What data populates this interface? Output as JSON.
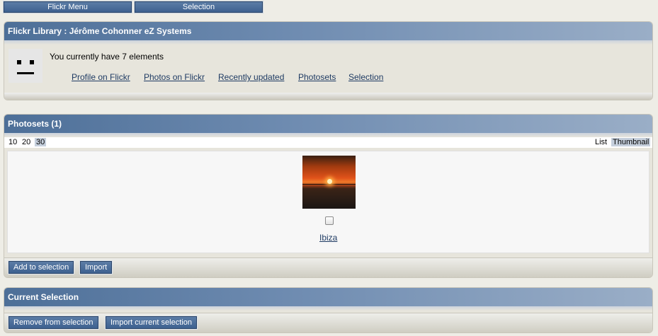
{
  "topnav": {
    "menu_label": "Flickr Menu",
    "selection_label": "Selection"
  },
  "library": {
    "title": "Flickr Library : Jérôme Cohonner eZ Systems",
    "count_text": "You currently have 7 elements",
    "links": [
      "Profile on Flickr",
      "Photos on Flickr",
      "Recently updated",
      "Photosets",
      "Selection"
    ]
  },
  "photosets": {
    "title": "Photosets (1)",
    "page_sizes": [
      "10",
      "20",
      "30"
    ],
    "page_size_selected": "30",
    "view_modes": [
      "List",
      "Thumbnail"
    ],
    "view_mode_selected": "Thumbnail",
    "items": [
      {
        "title": "Ibiza",
        "checked": false
      }
    ],
    "add_label": "Add to selection",
    "import_label": "Import"
  },
  "current_selection": {
    "title": "Current Selection",
    "remove_label": "Remove from selection",
    "import_current_label": "Import current selection"
  }
}
